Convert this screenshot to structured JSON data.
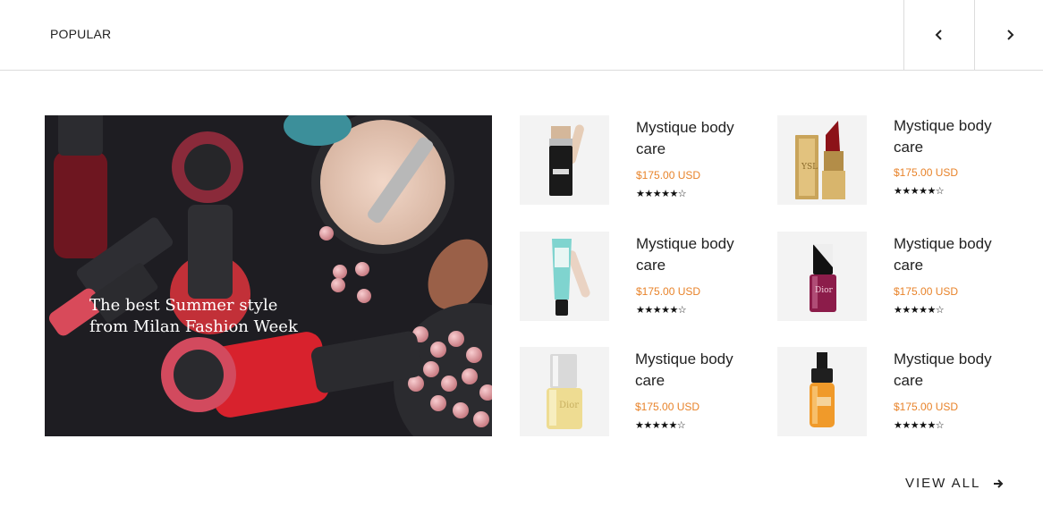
{
  "header": {
    "section_title": "POPULAR",
    "prev_icon": "chevron-left-icon",
    "next_icon": "chevron-right-icon"
  },
  "hero": {
    "caption": "The best Summer style\nfrom Milan Fashion Week"
  },
  "products": [
    {
      "name": "Mystique body care",
      "price": "$175.00 USD",
      "rating": "★★★★★☆",
      "image": "foundation-stick"
    },
    {
      "name": "Mystique body care",
      "price": "$175.00 USD",
      "rating": "★★★★★☆",
      "image": "lipstick"
    },
    {
      "name": "Mystique body care",
      "price": "$175.00 USD",
      "rating": "★★★★★☆",
      "image": "primer-tube"
    },
    {
      "name": "Mystique body care",
      "price": "$175.00 USD",
      "rating": "★★★★★☆",
      "image": "nail-polish-plum"
    },
    {
      "name": "Mystique body care",
      "price": "$175.00 USD",
      "rating": "★★★★★☆",
      "image": "nail-polish-yellow"
    },
    {
      "name": "Mystique body care",
      "price": "$175.00 USD",
      "rating": "★★★★★☆",
      "image": "serum-bottle"
    }
  ],
  "footer": {
    "view_all_label": "VIEW ALL",
    "view_all_icon": "arrow-right-icon"
  },
  "colors": {
    "price": "#e8832a",
    "border": "#dcdcdc",
    "thumb_bg": "#f3f3f3"
  }
}
